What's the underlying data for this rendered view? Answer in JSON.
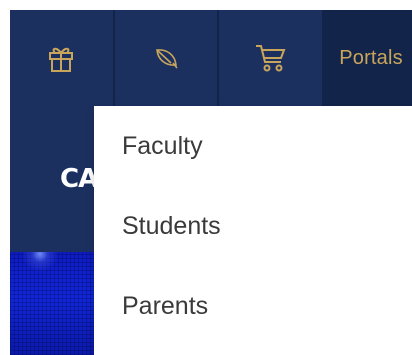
{
  "nav": {
    "accent_color": "#c8a55b",
    "background_color": "#172a55",
    "icons": [
      "gift-icon",
      "leaf-icon",
      "cart-icon"
    ],
    "portals_label": "Portals"
  },
  "hero": {
    "title": "CA"
  },
  "portals_menu": {
    "items": [
      {
        "label": "Faculty"
      },
      {
        "label": "Students"
      },
      {
        "label": "Parents"
      }
    ]
  }
}
